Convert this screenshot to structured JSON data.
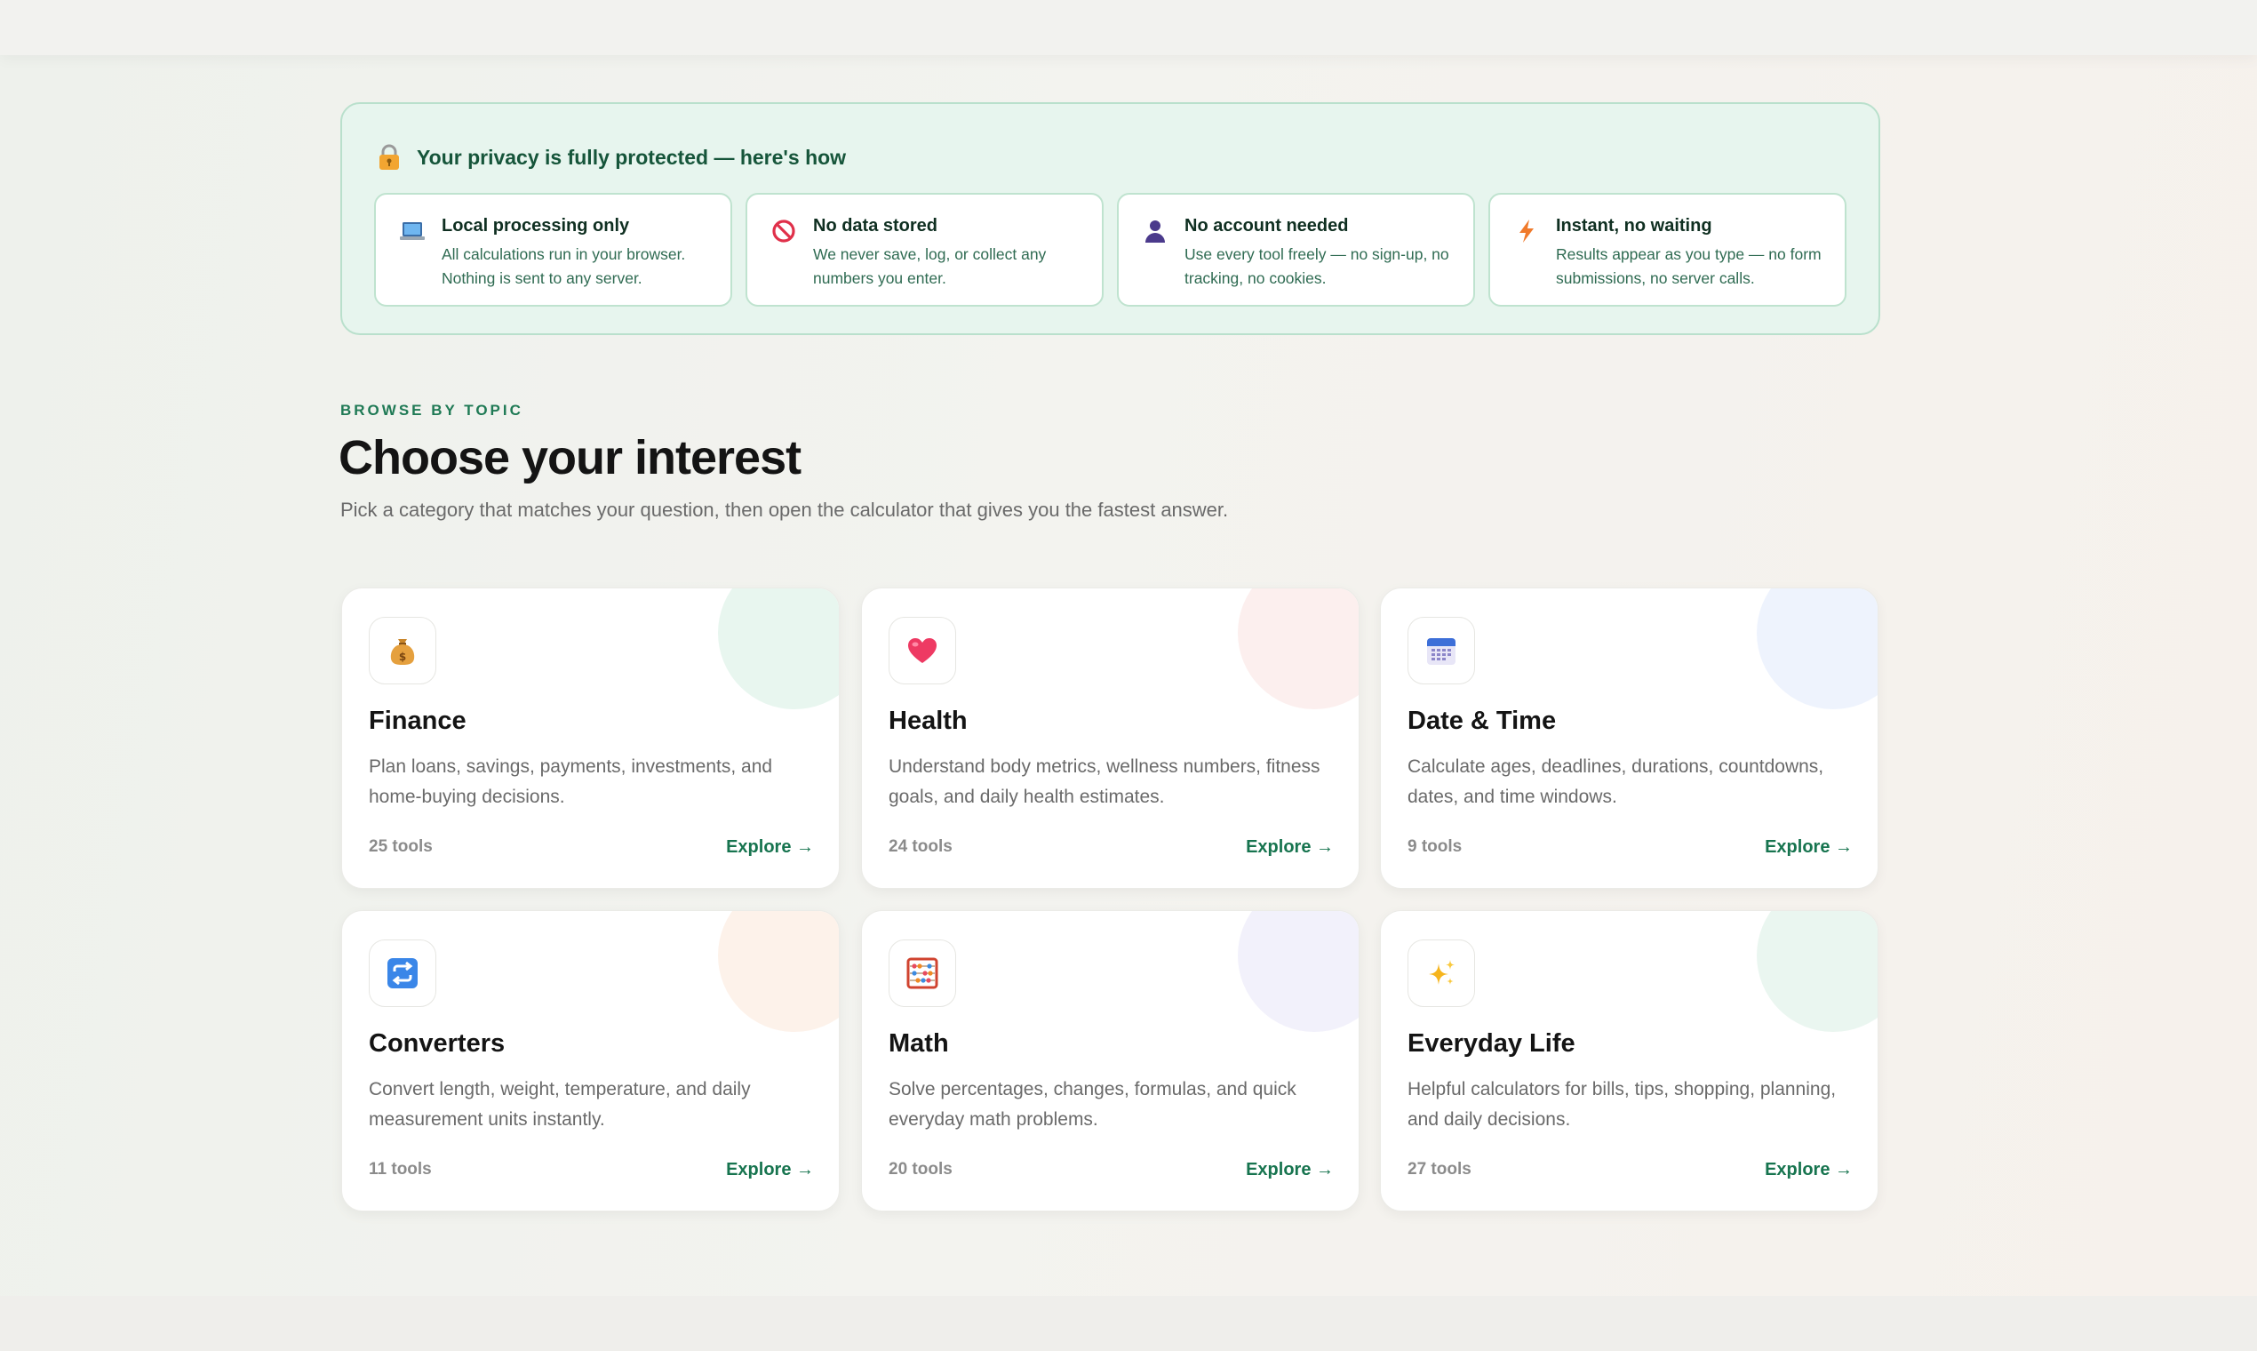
{
  "colors": {
    "accent": "#17744f",
    "privacy_bg": "#e7f5ee",
    "privacy_border": "#b9e0cc"
  },
  "privacy": {
    "icon": "lock-icon",
    "title": "Your privacy is fully protected — here's how",
    "items": [
      {
        "icon": "laptop-icon",
        "title": "Local processing only",
        "text": "All calculations run in your browser. Nothing is sent to any server."
      },
      {
        "icon": "no-entry-icon",
        "title": "No data stored",
        "text": "We never save, log, or collect any numbers you enter."
      },
      {
        "icon": "user-icon",
        "title": "No account needed",
        "text": "Use every tool freely — no sign-up, no tracking, no cookies."
      },
      {
        "icon": "lightning-icon",
        "title": "Instant, no waiting",
        "text": "Results appear as you type — no form submissions, no server calls."
      }
    ]
  },
  "topics": {
    "eyebrow": "BROWSE BY TOPIC",
    "title": "Choose your interest",
    "subtitle": "Pick a category that matches your question, then open the calculator that gives you the fastest answer.",
    "categories": [
      {
        "icon": "money-bag-icon",
        "title": "Finance",
        "description": "Plan loans, savings, payments, investments, and home-buying decisions.",
        "count": "25 tools",
        "explore": "Explore →",
        "tint": "#e8f6ef"
      },
      {
        "icon": "heart-icon",
        "title": "Health",
        "description": "Understand body metrics, wellness numbers, fitness goals, and daily health estimates.",
        "count": "24 tools",
        "explore": "Explore →",
        "tint": "#fcefee"
      },
      {
        "icon": "calendar-icon",
        "title": "Date & Time",
        "description": "Calculate ages, deadlines, durations, countdowns, dates, and time windows.",
        "count": "9 tools",
        "explore": "Explore →",
        "tint": "#eef3fd"
      },
      {
        "icon": "repeat-icon",
        "title": "Converters",
        "description": "Convert length, weight, temperature, and daily measurement units instantly.",
        "count": "11 tools",
        "explore": "Explore →",
        "tint": "#fdf2ea"
      },
      {
        "icon": "abacus-icon",
        "title": "Math",
        "description": "Solve percentages, changes, formulas, and quick everyday math problems.",
        "count": "20 tools",
        "explore": "Explore →",
        "tint": "#f2f1fb"
      },
      {
        "icon": "sparkles-icon",
        "title": "Everyday Life",
        "description": "Helpful calculators for bills, tips, shopping, planning, and daily decisions.",
        "count": "27 tools",
        "explore": "Explore →",
        "tint": "#eaf6f0"
      }
    ]
  }
}
